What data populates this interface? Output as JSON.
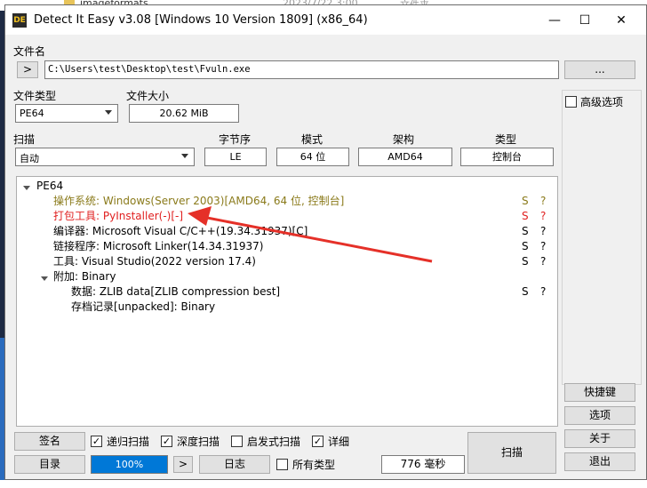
{
  "background": {
    "date_text": "2023/7/22 3:00",
    "folder_name": "imageformats",
    "type_text": "文件夹"
  },
  "window": {
    "title": "Detect It Easy v3.08 [Windows 10 Version 1809] (x86_64)",
    "icon_text": "DE",
    "minimize": "—",
    "maximize": "☐",
    "close": "✕"
  },
  "file": {
    "label": "文件名",
    "nav_button": ">",
    "path": "C:\\Users\\test\\Desktop\\test\\Fvuln.exe",
    "browse_button": "..."
  },
  "file_type": {
    "label": "文件类型",
    "value": "PE64"
  },
  "file_size": {
    "label": "文件大小",
    "value": "20.62 MiB"
  },
  "scan": {
    "label": "扫描",
    "mode": "自动",
    "endian_label": "字节序",
    "endian_value": "LE",
    "mode_label": "模式",
    "mode_value": "64 位",
    "arch_label": "架构",
    "arch_value": "AMD64",
    "type_label": "类型",
    "type_value": "控制台"
  },
  "advanced_label": "高级选项",
  "tree": {
    "root": "PE64",
    "rows": [
      {
        "text": "操作系统: Windows(Server 2003)[AMD64, 64 位, 控制台]",
        "s": "S",
        "q": "?",
        "color": "#8a7a1a"
      },
      {
        "text": "打包工具: PyInstaller(-)[-]",
        "s": "S",
        "q": "?",
        "color": "#e02020"
      },
      {
        "text": "编译器: Microsoft Visual C/C++(19.34.31937)[C]",
        "s": "S",
        "q": "?",
        "color": "#000000"
      },
      {
        "text": "链接程序: Microsoft Linker(14.34.31937)",
        "s": "S",
        "q": "?",
        "color": "#000000"
      },
      {
        "text": "工具: Visual Studio(2022 version 17.4)",
        "s": "S",
        "q": "?",
        "color": "#000000"
      }
    ],
    "overlay": {
      "text": "附加: Binary"
    },
    "overlay_children": [
      {
        "text": "数据: ZLIB data[ZLIB compression best]",
        "s": "S",
        "q": "?"
      },
      {
        "text": "存档记录[unpacked]: Binary",
        "s": "",
        "q": ""
      }
    ]
  },
  "side_buttons": {
    "shortcuts": "快捷键",
    "options": "选项",
    "about": "关于",
    "exit": "退出"
  },
  "bottom": {
    "signature": "签名",
    "recursive": "递归扫描",
    "deep": "深度扫描",
    "heuristic": "启发式扫描",
    "verbose": "详细",
    "directory": "目录",
    "progress": "100%",
    "progress_value": 100,
    "next": ">",
    "log": "日志",
    "all_types": "所有类型",
    "time": "776 毫秒",
    "scan_button": "扫描"
  },
  "checkboxes": {
    "advanced": false,
    "recursive": true,
    "deep": true,
    "heuristic": false,
    "verbose": true,
    "all_types": false
  },
  "colors": {
    "accent": "#0078d7",
    "detected": "#e02020",
    "os": "#8a7a1a",
    "annotation_arrow": "#e53028"
  }
}
